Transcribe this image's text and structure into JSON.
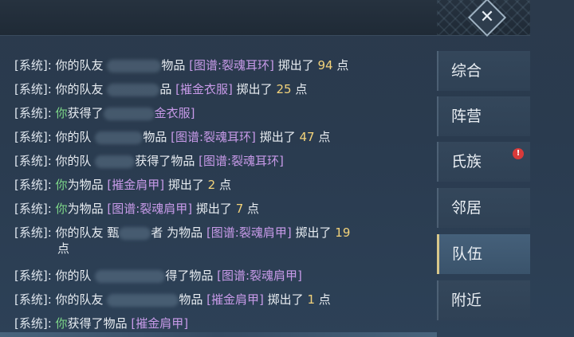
{
  "header": {
    "close_icon": "close-x-icon"
  },
  "tabs": [
    {
      "label": "综合",
      "active": false
    },
    {
      "label": "阵营",
      "active": false
    },
    {
      "label": "氏族",
      "active": false,
      "badge": "!"
    },
    {
      "label": "邻居",
      "active": false
    },
    {
      "label": "队伍",
      "active": true
    },
    {
      "label": "附近",
      "active": false
    }
  ],
  "messages": {
    "m0": {
      "sys": "[系统]:",
      "a": "你的队友",
      "b": "物品",
      "item": "[图谱:裂魂耳环]",
      "c": "掷出了",
      "num": "94",
      "d": "点"
    },
    "m1": {
      "sys": "[系统]:",
      "a": "你的队友",
      "b": "品",
      "item": "[摧金衣服]",
      "c": "掷出了",
      "num": "25",
      "d": "点"
    },
    "m2": {
      "sys": "[系统]:",
      "you": "你",
      "a": "获得了",
      "item": "金衣服]"
    },
    "m3": {
      "sys": "[系统]:",
      "a": "你的队",
      "b": "物品",
      "item": "[图谱:裂魂耳环]",
      "c": "掷出了",
      "num": "47",
      "d": "点"
    },
    "m4": {
      "sys": "[系统]:",
      "a": "你的队",
      "b": "获得了物品",
      "item": "[图谱:裂魂耳环]"
    },
    "m5": {
      "sys": "[系统]:",
      "you": "你",
      "a": "为物品",
      "item": "[摧金肩甲]",
      "c": "掷出了",
      "num": "2",
      "d": "点"
    },
    "m6": {
      "sys": "[系统]:",
      "you": "你",
      "a": "为物品",
      "item": "[图谱:裂魂肩甲]",
      "c": "掷出了",
      "num": "7",
      "d": "点"
    },
    "m7": {
      "sys": "[系统]:",
      "a": "你的队友",
      "b": "甄",
      "b2": "者",
      "b3": "为物品",
      "item": "[图谱:裂魂肩甲]",
      "c": "掷出了",
      "num": "19",
      "d": "点"
    },
    "m8": {
      "sys": "[系统]:",
      "a": "你的队",
      "b": "得了物品",
      "item": "[图谱:裂魂肩甲]"
    },
    "m9": {
      "sys": "[系统]:",
      "a": "你的队友",
      "b": "物品",
      "item": "[摧金肩甲]",
      "c": "掷出了",
      "num": "1",
      "d": "点"
    },
    "m10": {
      "sys": "[系统]:",
      "you": "你",
      "a": "获得了物品",
      "item": "[摧金肩甲]"
    }
  }
}
